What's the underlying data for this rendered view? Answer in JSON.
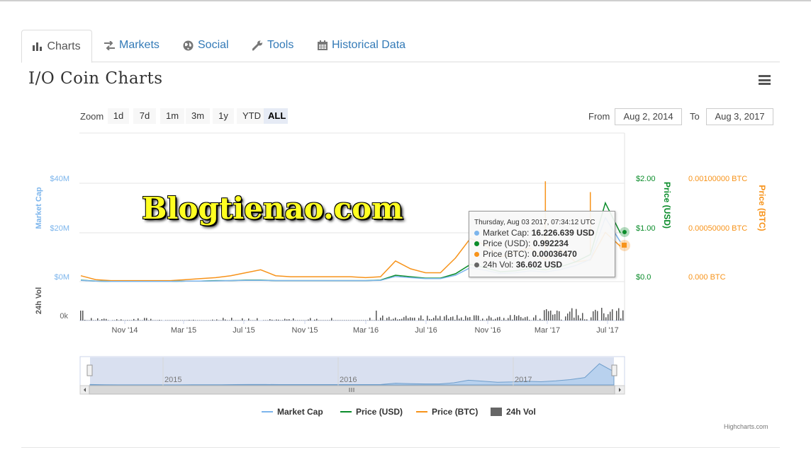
{
  "tabs": [
    {
      "label": "Charts",
      "icon": "bar-chart-icon"
    },
    {
      "label": "Markets",
      "icon": "exchange-icon"
    },
    {
      "label": "Social",
      "icon": "globe-icon"
    },
    {
      "label": "Tools",
      "icon": "wrench-icon"
    },
    {
      "label": "Historical Data",
      "icon": "calendar-icon"
    }
  ],
  "title": "I/O Coin Charts",
  "zoom": {
    "label": "Zoom",
    "options": [
      "1d",
      "7d",
      "1m",
      "3m",
      "1y",
      "YTD",
      "ALL"
    ],
    "selected": "ALL"
  },
  "range": {
    "from_label": "From",
    "from_value": "Aug 2, 2014",
    "to_label": "To",
    "to_value": "Aug 3, 2017"
  },
  "watermark": "Blogtienao.com",
  "tooltip": {
    "date": "Thursday, Aug 03 2017, 07:34:12 UTC",
    "rows": [
      {
        "label": "Market Cap:",
        "value": "16.226.639 USD",
        "color": "#7cb5ec"
      },
      {
        "label": "Price (USD):",
        "value": "0.992234",
        "color": "#0a8c2a"
      },
      {
        "label": "Price (BTC):",
        "value": "0.00036470",
        "color": "#f7931a"
      },
      {
        "label": "24h Vol:",
        "value": "36.602 USD",
        "color": "#666666"
      }
    ]
  },
  "credit": "Highcharts.com",
  "colors": {
    "market_cap": "#7cb5ec",
    "price_usd": "#0a8c2a",
    "price_btc": "#f7931a",
    "volume": "#555555",
    "tab_link": "#337ab7"
  },
  "chart_data": {
    "type": "line",
    "title": "",
    "x_tick_labels": [
      "Nov '14",
      "Mar '15",
      "Jul '15",
      "Nov '15",
      "Mar '16",
      "Jul '16",
      "Nov '16",
      "Mar '17",
      "Jul '17"
    ],
    "axes": {
      "market_cap": {
        "title": "Market Cap",
        "ticks": [
          "$0M",
          "$20M",
          "$40M"
        ],
        "range": [
          0,
          40
        ]
      },
      "price_usd": {
        "title": "Price (USD)",
        "ticks": [
          "$0.0",
          "$1.00",
          "$2.00"
        ],
        "range": [
          0,
          2
        ]
      },
      "price_btc": {
        "title": "Price (BTC)",
        "ticks": [
          "0.000 BTC",
          "0.00050000 BTC",
          "0.00100000 BTC"
        ],
        "range": [
          0,
          0.001
        ]
      },
      "volume": {
        "title": "24h Vol",
        "ticks": [
          "0k"
        ]
      }
    },
    "x_months": [
      0,
      1,
      2,
      3,
      4,
      5,
      6,
      7,
      8,
      9,
      10,
      11,
      12,
      13,
      14,
      15,
      16,
      17,
      18,
      19,
      20,
      21,
      22,
      23,
      24,
      25,
      26,
      27,
      28,
      29,
      30,
      31,
      32,
      33,
      34,
      35,
      36
    ],
    "series": [
      {
        "name": "Price (BTC)",
        "axis": "price_btc",
        "values": [
          6e-05,
          2e-05,
          1e-05,
          1e-05,
          1e-05,
          1e-05,
          1e-05,
          2e-05,
          3e-05,
          4e-05,
          6e-05,
          9e-05,
          0.00012,
          6e-05,
          5e-05,
          5e-05,
          5e-05,
          5e-05,
          5e-05,
          4e-05,
          5e-05,
          0.00021,
          0.00013,
          9e-05,
          9e-05,
          0.00024,
          0.00044,
          0.00037,
          0.00025,
          0.0003,
          0.00034,
          0.00022,
          0.00033,
          0.0002,
          0.00022,
          0.0005,
          0.00036
        ]
      },
      {
        "name": "Price (USD)",
        "axis": "price_usd",
        "values": [
          0.03,
          0.01,
          0.005,
          0.005,
          0.005,
          0.005,
          0.005,
          0.01,
          0.01,
          0.02,
          0.02,
          0.03,
          0.03,
          0.02,
          0.02,
          0.02,
          0.02,
          0.02,
          0.02,
          0.02,
          0.03,
          0.13,
          0.1,
          0.07,
          0.07,
          0.16,
          0.35,
          0.28,
          0.2,
          0.22,
          0.27,
          0.24,
          0.3,
          0.4,
          0.55,
          1.6,
          0.99
        ]
      },
      {
        "name": "Market Cap",
        "axis": "market_cap",
        "values": [
          0.5,
          0.2,
          0.1,
          0.1,
          0.1,
          0.1,
          0.1,
          0.2,
          0.2,
          0.3,
          0.4,
          0.5,
          0.5,
          0.4,
          0.4,
          0.4,
          0.4,
          0.4,
          0.4,
          0.4,
          0.5,
          2.1,
          1.6,
          1.2,
          1.2,
          2.6,
          5.7,
          4.6,
          3.3,
          3.6,
          4.4,
          3.9,
          4.9,
          6.5,
          9.0,
          26.0,
          16.2
        ]
      }
    ],
    "spikes_btc": [
      {
        "month": 31,
        "value": 0.00102
      },
      {
        "month": 34,
        "value": 0.00091
      }
    ],
    "navigator_labels": [
      "2015",
      "2016",
      "2017"
    ],
    "legend": [
      "Market Cap",
      "Price (USD)",
      "Price (BTC)",
      "24h Vol"
    ],
    "legend_position": "bottom-center"
  }
}
